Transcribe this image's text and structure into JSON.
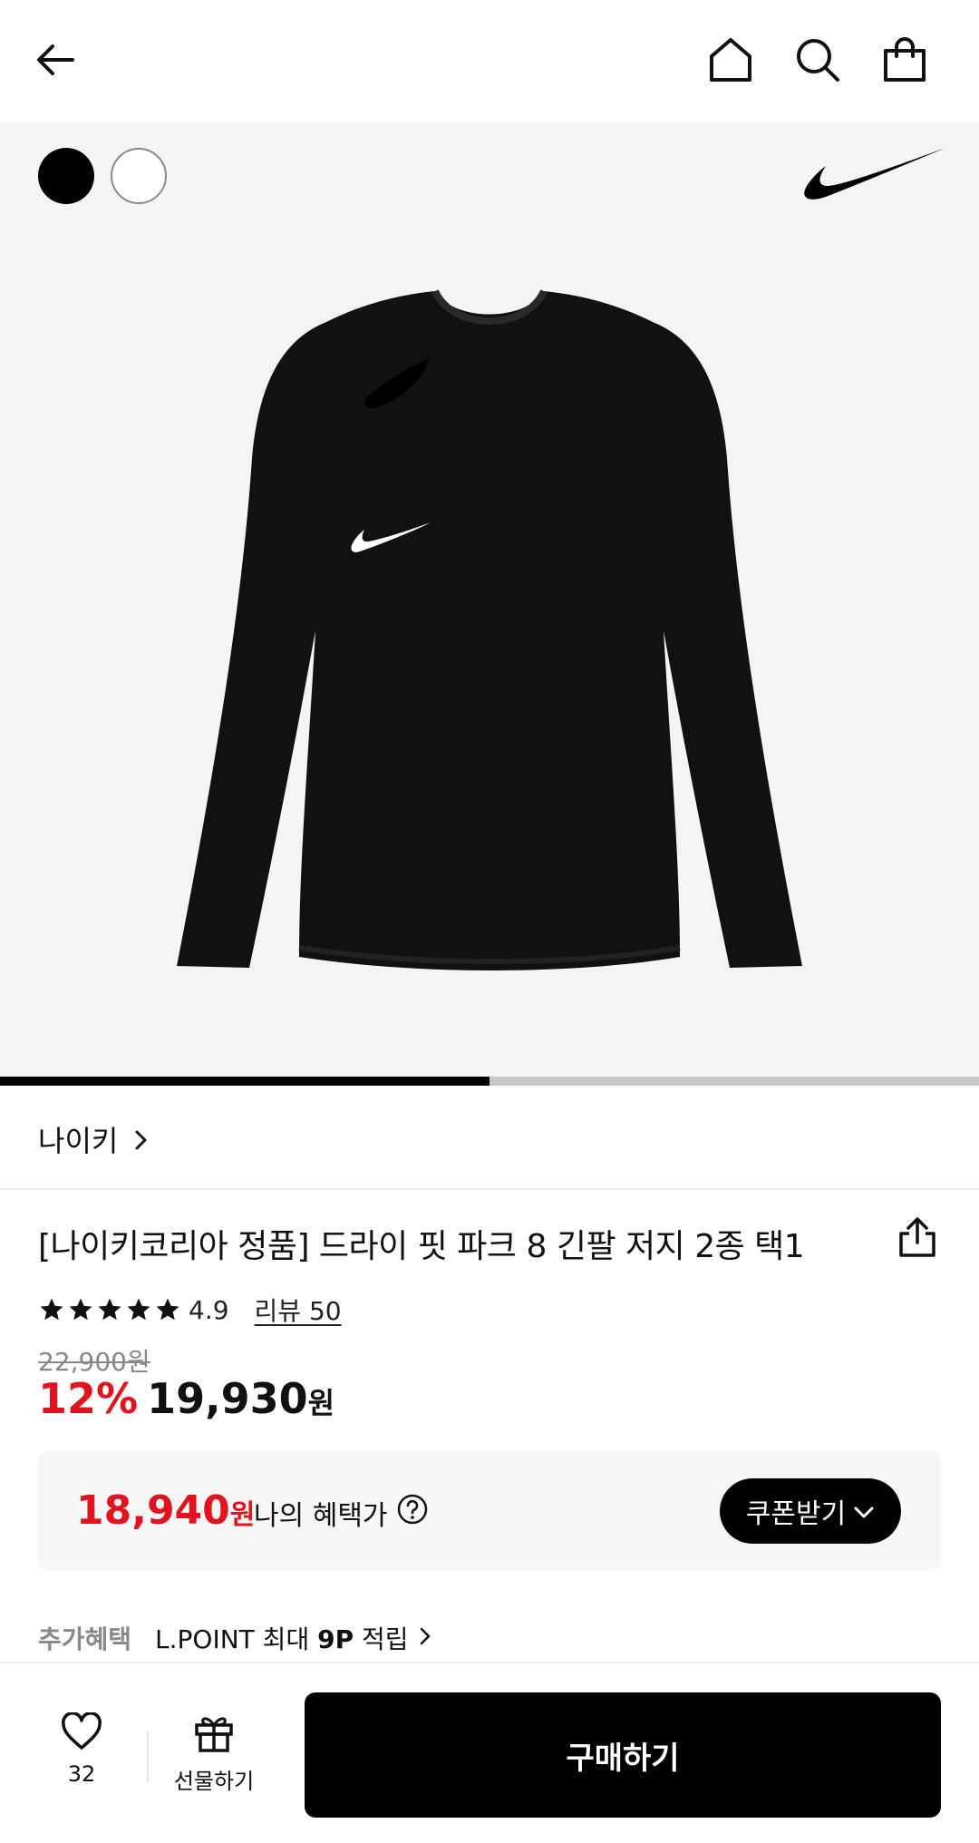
{
  "topbar": {
    "icons": [
      "back-arrow-icon",
      "home-icon",
      "search-icon",
      "shopping-bag-icon"
    ]
  },
  "gallery": {
    "swatches": [
      "black",
      "white"
    ],
    "brand_logo": "nike-swoosh-logo",
    "image_subject": "black long-sleeve jersey",
    "progress_fraction": 0.5
  },
  "brand": {
    "name": "나이키"
  },
  "product": {
    "title": "[나이키코리아 정품] 드라이 핏 파크 8 긴팔 저지 2종 택1",
    "rating": "4.9",
    "stars": 5,
    "review_link": "리뷰 50",
    "original_price": "22,900원",
    "discount": "12%",
    "price": "19,930",
    "price_unit": "원"
  },
  "benefit": {
    "price": "18,940",
    "price_unit": "원",
    "label": "나의 혜택가",
    "coupon_button": "쿠폰받기"
  },
  "extra": {
    "label": "추가혜택",
    "text_prefix": "L.POINT 최대 ",
    "points": "9P",
    "text_suffix": " 적립"
  },
  "bottom_bar": {
    "like_count": "32",
    "gift_label": "선물하기",
    "buy_button": "구매하기"
  },
  "colors": {
    "accent_red": "#e0141e",
    "primary_black": "#000000",
    "gallery_bg": "#f4f4f4"
  }
}
